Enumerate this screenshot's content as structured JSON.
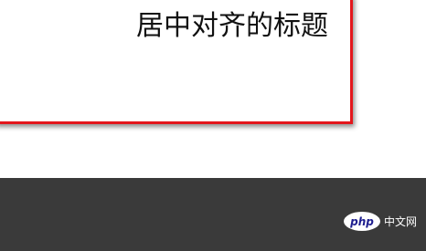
{
  "heading": {
    "text": "居中对齐的标题"
  },
  "watermark": {
    "logo_text": "php",
    "site_label": "中文网"
  },
  "colors": {
    "border_red": "#e3161c",
    "bottom_bar": "#3a3a3a"
  }
}
